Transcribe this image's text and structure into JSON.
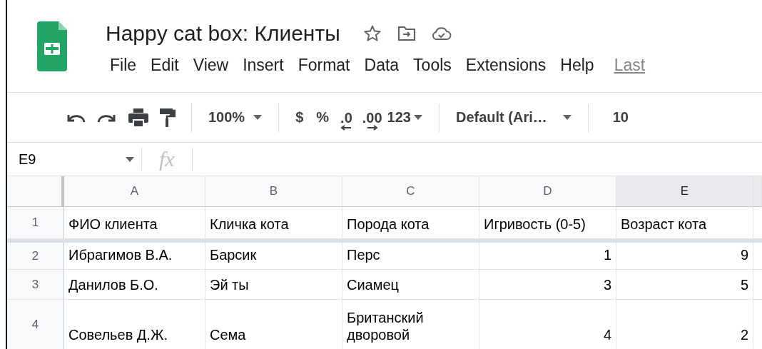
{
  "document": {
    "title": "Happy cat box: Клиенты"
  },
  "menu": [
    "File",
    "Edit",
    "View",
    "Insert",
    "Format",
    "Data",
    "Tools",
    "Extensions",
    "Help"
  ],
  "last_edit_link": "Last",
  "toolbar": {
    "zoom": "100%",
    "currency": "$",
    "percent": "%",
    "decrease_decimals": ".0",
    "increase_decimals": ".00",
    "number_format": "123",
    "font": "Default (Ari…",
    "font_size": "10"
  },
  "formula_bar": {
    "cell_ref": "E9",
    "fx": "fx"
  },
  "columns": [
    {
      "label": "A",
      "selected": false
    },
    {
      "label": "B",
      "selected": false
    },
    {
      "label": "C",
      "selected": false
    },
    {
      "label": "D",
      "selected": false
    },
    {
      "label": "E",
      "selected": true
    }
  ],
  "rows": [
    {
      "number": "1",
      "cells": [
        {
          "text": "ФИО клиента",
          "kind": "text"
        },
        {
          "text": "Кличка кота",
          "kind": "text"
        },
        {
          "text": "Порода кота",
          "kind": "text"
        },
        {
          "text": "Игривость (0-5)",
          "kind": "text"
        },
        {
          "text": "Возраст кота",
          "kind": "text"
        }
      ]
    },
    {
      "number": "2",
      "cells": [
        {
          "text": "Ибрагимов В.А.",
          "kind": "text"
        },
        {
          "text": "Барсик",
          "kind": "text"
        },
        {
          "text": "Перс",
          "kind": "text"
        },
        {
          "text": "1",
          "kind": "number"
        },
        {
          "text": "9",
          "kind": "number"
        }
      ]
    },
    {
      "number": "3",
      "cells": [
        {
          "text": "Данилов Б.О.",
          "kind": "text"
        },
        {
          "text": "Эй ты",
          "kind": "text"
        },
        {
          "text": "Сиамец",
          "kind": "text"
        },
        {
          "text": "3",
          "kind": "number"
        },
        {
          "text": "5",
          "kind": "number"
        }
      ]
    },
    {
      "number": "4",
      "cells": [
        {
          "text": "Совельев Д.Ж.",
          "kind": "text"
        },
        {
          "text": "Сема",
          "kind": "text"
        },
        {
          "text": "Британский дворовой",
          "kind": "text"
        },
        {
          "text": "4",
          "kind": "number"
        },
        {
          "text": "2",
          "kind": "number"
        }
      ]
    }
  ]
}
